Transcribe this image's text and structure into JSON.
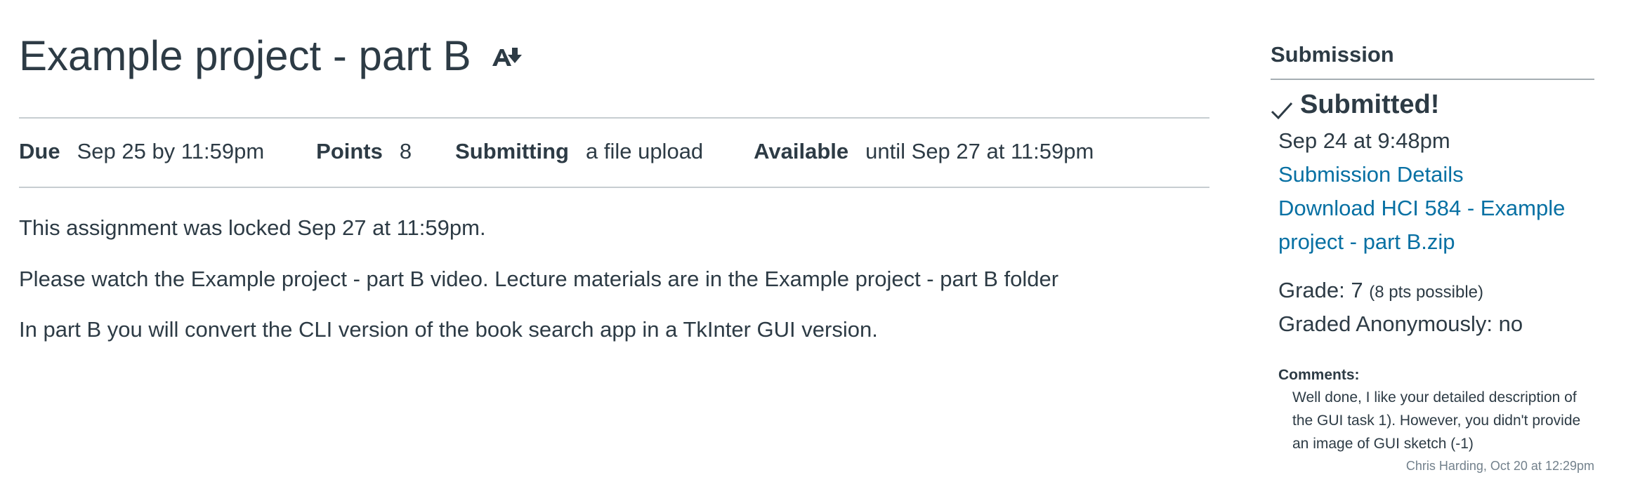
{
  "assignment": {
    "title": "Example project - part B",
    "icons": {
      "immersive_reader": "immersive-reader-icon"
    },
    "details": {
      "due_label": "Due",
      "due_value": "Sep 25 by 11:59pm",
      "points_label": "Points",
      "points_value": "8",
      "submitting_label": "Submitting",
      "submitting_value": "a file upload",
      "available_label": "Available",
      "available_value": "until Sep 27 at 11:59pm"
    },
    "description": {
      "locked_notice": "This assignment was locked Sep 27 at 11:59pm.",
      "paragraph_1": "Please watch the Example project - part B video. Lecture materials are in the Example project - part B folder",
      "paragraph_2": "In part B you will convert the CLI version of the book search app in a TkInter GUI version."
    }
  },
  "submission": {
    "heading": "Submission",
    "status_icon": "check-icon",
    "status": "Submitted!",
    "submitted_at": "Sep 24 at 9:48pm",
    "details_link": "Submission Details",
    "download_link": "Download HCI 584 - Example project - part B.zip",
    "grade_label": "Grade: 7",
    "grade_possible": "(8 pts possible)",
    "anonymous": "Graded Anonymously: no",
    "comments_label": "Comments:",
    "comment_text": "Well done, I like your detailed description of the GUI task 1). However, you didn't provide an image of GUI sketch (-1)",
    "comment_author": "Chris Harding, Oct 20 at 12:29pm"
  },
  "colors": {
    "text": "#2d3b45",
    "link": "#0770a3",
    "rule": "#c7cdd1",
    "muted": "#73818c"
  }
}
